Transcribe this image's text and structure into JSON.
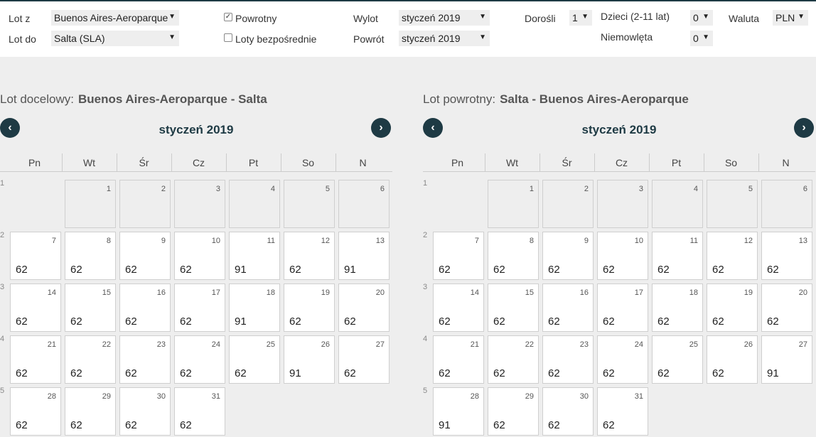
{
  "form": {
    "from_label": "Lot z",
    "from_value": "Buenos Aires-Aeroparque",
    "to_label": "Lot do",
    "to_value": "Salta (SLA)",
    "return_label": "Powrotny",
    "return_checked": true,
    "direct_label": "Loty bezpośrednie",
    "direct_checked": false,
    "departure_label": "Wylot",
    "departure_value": "styczeń 2019",
    "return_date_label": "Powrót",
    "return_date_value": "styczeń 2019",
    "adults_label": "Dorośli",
    "adults_value": "1",
    "children_label": "Dzieci (2-11 lat)",
    "children_value": "0",
    "infants_label": "Niemowlęta",
    "infants_value": "0",
    "currency_label": "Waluta",
    "currency_value": "PLN",
    "caret": "▼"
  },
  "weekdays": [
    "Pn",
    "Wt",
    "Śr",
    "Cz",
    "Pt",
    "So",
    "N"
  ],
  "week_numbers": [
    "1",
    "2",
    "3",
    "4",
    "5"
  ],
  "icons": {
    "prev": "prev-month-icon",
    "next": "next-month-icon"
  },
  "colors": {
    "accent": "#1e3a44",
    "background": "#eeeeee"
  },
  "calendars": [
    {
      "title_label": "Lot docelowy:",
      "title_route": "Buenos Aires-Aeroparque - Salta",
      "month": "styczeń 2019",
      "weeks": [
        [
          null,
          {
            "d": "1",
            "p": ""
          },
          {
            "d": "2",
            "p": ""
          },
          {
            "d": "3",
            "p": ""
          },
          {
            "d": "4",
            "p": ""
          },
          {
            "d": "5",
            "p": ""
          },
          {
            "d": "6",
            "p": ""
          }
        ],
        [
          {
            "d": "7",
            "p": "62"
          },
          {
            "d": "8",
            "p": "62"
          },
          {
            "d": "9",
            "p": "62"
          },
          {
            "d": "10",
            "p": "62"
          },
          {
            "d": "11",
            "p": "91"
          },
          {
            "d": "12",
            "p": "62"
          },
          {
            "d": "13",
            "p": "91"
          }
        ],
        [
          {
            "d": "14",
            "p": "62"
          },
          {
            "d": "15",
            "p": "62"
          },
          {
            "d": "16",
            "p": "62"
          },
          {
            "d": "17",
            "p": "62"
          },
          {
            "d": "18",
            "p": "91"
          },
          {
            "d": "19",
            "p": "62"
          },
          {
            "d": "20",
            "p": "62"
          }
        ],
        [
          {
            "d": "21",
            "p": "62"
          },
          {
            "d": "22",
            "p": "62"
          },
          {
            "d": "23",
            "p": "62"
          },
          {
            "d": "24",
            "p": "62"
          },
          {
            "d": "25",
            "p": "62"
          },
          {
            "d": "26",
            "p": "91"
          },
          {
            "d": "27",
            "p": "62"
          }
        ],
        [
          {
            "d": "28",
            "p": "62"
          },
          {
            "d": "29",
            "p": "62"
          },
          {
            "d": "30",
            "p": "62"
          },
          {
            "d": "31",
            "p": "62"
          },
          null,
          null,
          null
        ]
      ]
    },
    {
      "title_label": "Lot powrotny:",
      "title_route": "Salta - Buenos Aires-Aeroparque",
      "month": "styczeń 2019",
      "weeks": [
        [
          null,
          {
            "d": "1",
            "p": ""
          },
          {
            "d": "2",
            "p": ""
          },
          {
            "d": "3",
            "p": ""
          },
          {
            "d": "4",
            "p": ""
          },
          {
            "d": "5",
            "p": ""
          },
          {
            "d": "6",
            "p": ""
          }
        ],
        [
          {
            "d": "7",
            "p": "62"
          },
          {
            "d": "8",
            "p": "62"
          },
          {
            "d": "9",
            "p": "62"
          },
          {
            "d": "10",
            "p": "62"
          },
          {
            "d": "11",
            "p": "62"
          },
          {
            "d": "12",
            "p": "62"
          },
          {
            "d": "13",
            "p": "62"
          }
        ],
        [
          {
            "d": "14",
            "p": "62"
          },
          {
            "d": "15",
            "p": "62"
          },
          {
            "d": "16",
            "p": "62"
          },
          {
            "d": "17",
            "p": "62"
          },
          {
            "d": "18",
            "p": "62"
          },
          {
            "d": "19",
            "p": "62"
          },
          {
            "d": "20",
            "p": "62"
          }
        ],
        [
          {
            "d": "21",
            "p": "62"
          },
          {
            "d": "22",
            "p": "62"
          },
          {
            "d": "23",
            "p": "62"
          },
          {
            "d": "24",
            "p": "62"
          },
          {
            "d": "25",
            "p": "62"
          },
          {
            "d": "26",
            "p": "62"
          },
          {
            "d": "27",
            "p": "91"
          }
        ],
        [
          {
            "d": "28",
            "p": "91"
          },
          {
            "d": "29",
            "p": "62"
          },
          {
            "d": "30",
            "p": "62"
          },
          {
            "d": "31",
            "p": "62"
          },
          null,
          null,
          null
        ]
      ]
    }
  ]
}
